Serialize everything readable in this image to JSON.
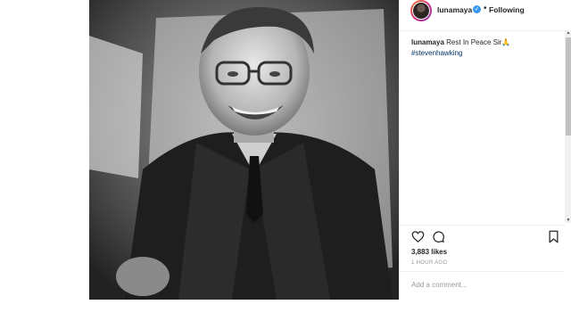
{
  "post": {
    "username": "lunamaya",
    "follow_status": "Following",
    "caption_user": "lunamaya",
    "caption_text": "Rest In Peace Sir🙏",
    "hashtag": "#stevenhawking",
    "likes": "3,883 likes",
    "time_ago": "1 HOUR AGO",
    "comment_placeholder": "Add a comment..."
  },
  "icons": {
    "like": "heart-icon",
    "comment": "comment-icon",
    "save": "bookmark-icon",
    "verified": "verified-badge-icon"
  },
  "colors": {
    "verified_blue": "#3897f0",
    "hashtag_blue": "#003569",
    "text_dark": "#262626",
    "text_muted": "#999999"
  }
}
